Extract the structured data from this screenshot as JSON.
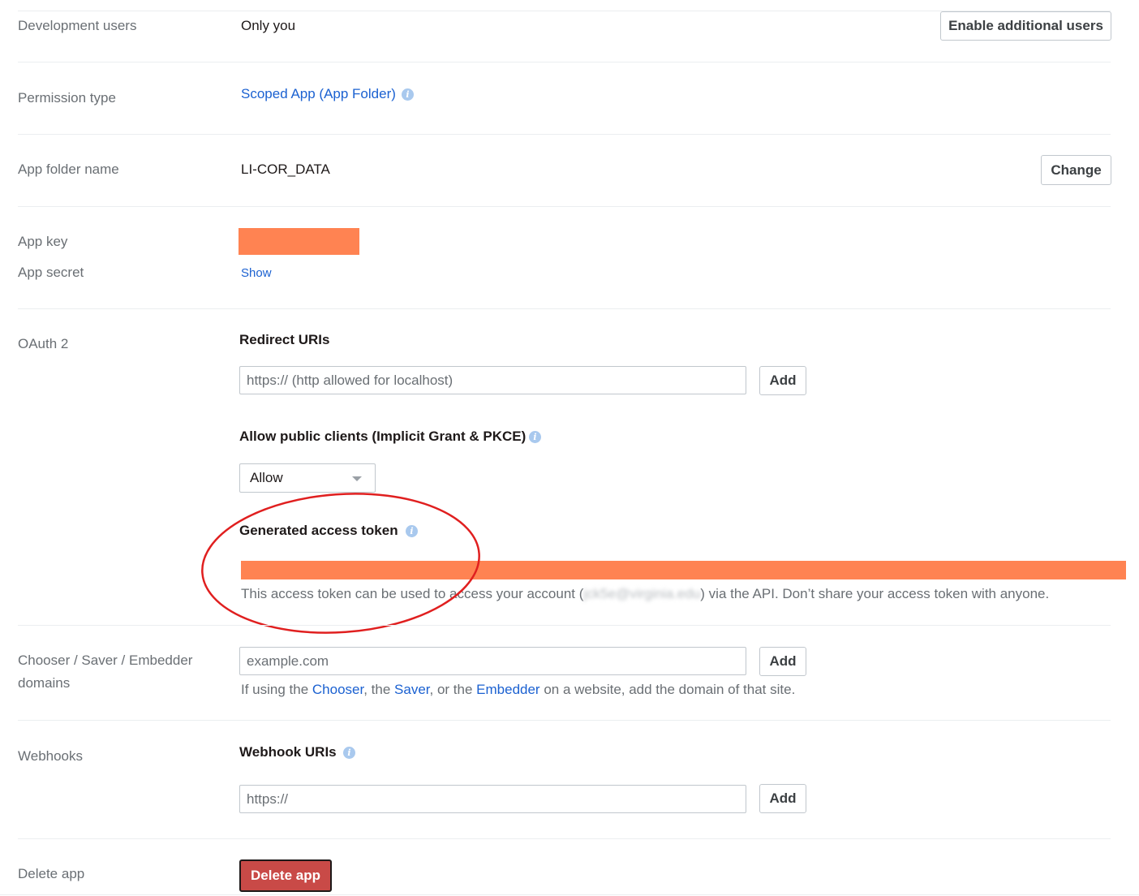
{
  "development_users": {
    "label": "Development users",
    "value": "Only you",
    "button": "Enable additional users"
  },
  "permission_type": {
    "label": "Permission type",
    "value": "Scoped App (App Folder)",
    "info_icon": "info-icon"
  },
  "app_folder": {
    "label": "App folder name",
    "value": "LI-COR_DATA",
    "button": "Change"
  },
  "app_key": {
    "label": "App key",
    "redacted_color": "#ff8352"
  },
  "app_secret": {
    "label": "App secret",
    "show_link": "Show"
  },
  "oauth2": {
    "label": "OAuth 2",
    "redirect_heading": "Redirect URIs",
    "redirect_placeholder": "https:// (http allowed for localhost)",
    "redirect_add": "Add",
    "public_clients_heading": "Allow public clients (Implicit Grant & PKCE)",
    "public_clients_selected": "Allow",
    "token_heading": "Generated access token",
    "token_help_prefix": "This access token can be used to access your account (",
    "token_help_email": "jck5e@virginia.edu",
    "token_help_suffix": ") via the API. Don’t share your access token with anyone.",
    "annotation_color": "#e01f1f"
  },
  "chooser": {
    "label_line1": "Chooser / Saver / Embedder",
    "label_line2": "domains",
    "placeholder": "example.com",
    "add": "Add",
    "help_prefix": "If using the ",
    "chooser_link": "Chooser",
    "sep1": ", the ",
    "saver_link": "Saver",
    "sep2": ", or the ",
    "embedder_link": "Embedder",
    "help_suffix": " on a website, add the domain of that site."
  },
  "webhooks": {
    "label": "Webhooks",
    "heading": "Webhook URIs",
    "placeholder": "https://",
    "add": "Add"
  },
  "delete_app": {
    "label": "Delete app",
    "button": "Delete app"
  }
}
